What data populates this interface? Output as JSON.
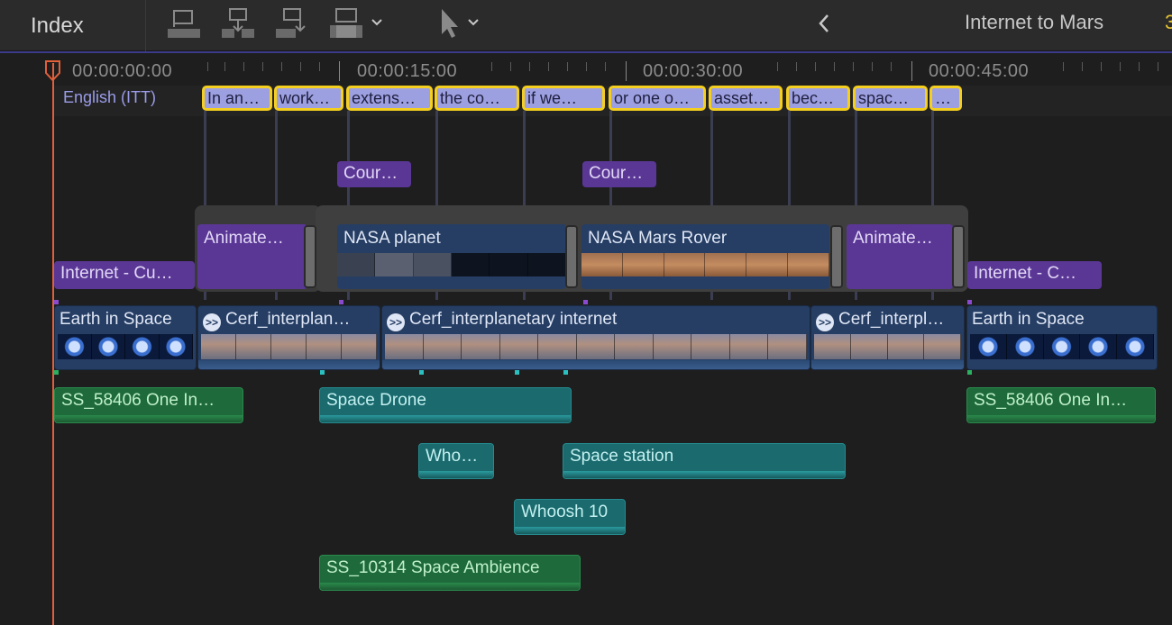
{
  "toolbar": {
    "index_label": "Index",
    "project_title": "Internet to Mars",
    "project_title_extra": "3",
    "tools": [
      "connect-icon",
      "insert-icon",
      "append-icon",
      "overwrite-icon"
    ],
    "select_tool": "arrow-icon"
  },
  "ruler": {
    "timecodes": [
      "00:00:00:00",
      "00:00:15:00",
      "00:00:30:00",
      "00:00:45:00"
    ]
  },
  "captions": {
    "lane_label": "English (ITT)",
    "items": [
      "In an…",
      "work…",
      "extens…",
      "the co…",
      "if we…",
      "or one o…",
      "asset…",
      "bec…",
      "spac…",
      "…"
    ]
  },
  "titles": {
    "course_1": "Cour…",
    "course_2": "Cour…",
    "internet_left": "Internet - Cu…",
    "internet_right": "Internet - C…"
  },
  "broll": {
    "animate_1": "Animate…",
    "nasa_planet": "NASA planet",
    "nasa_rover": "NASA Mars Rover",
    "animate_2": "Animate…"
  },
  "primary": {
    "earth_1": "Earth in Space",
    "cerf_1": "Cerf_interplan…",
    "cerf_2": "Cerf_interplanetary internet",
    "cerf_3": "Cerf_interpl…",
    "earth_2": "Earth in Space"
  },
  "audio": {
    "ss_one_left": "SS_58406 One In…",
    "space_drone": "Space Drone",
    "whoosh_short": "Who…",
    "space_station": "Space station",
    "whoosh_10": "Whoosh 10",
    "space_ambience": "SS_10314 Space Ambience",
    "ss_one_right": "SS_58406 One In…"
  },
  "colors": {
    "caption_fill": "#9da0e0",
    "caption_border": "#f5cf1f",
    "title_purple": "#5a3795",
    "video_blue": "#263e64",
    "audio_green": "#1e6a3a",
    "audio_teal": "#1a6a6e",
    "playhead": "#e0603a"
  }
}
